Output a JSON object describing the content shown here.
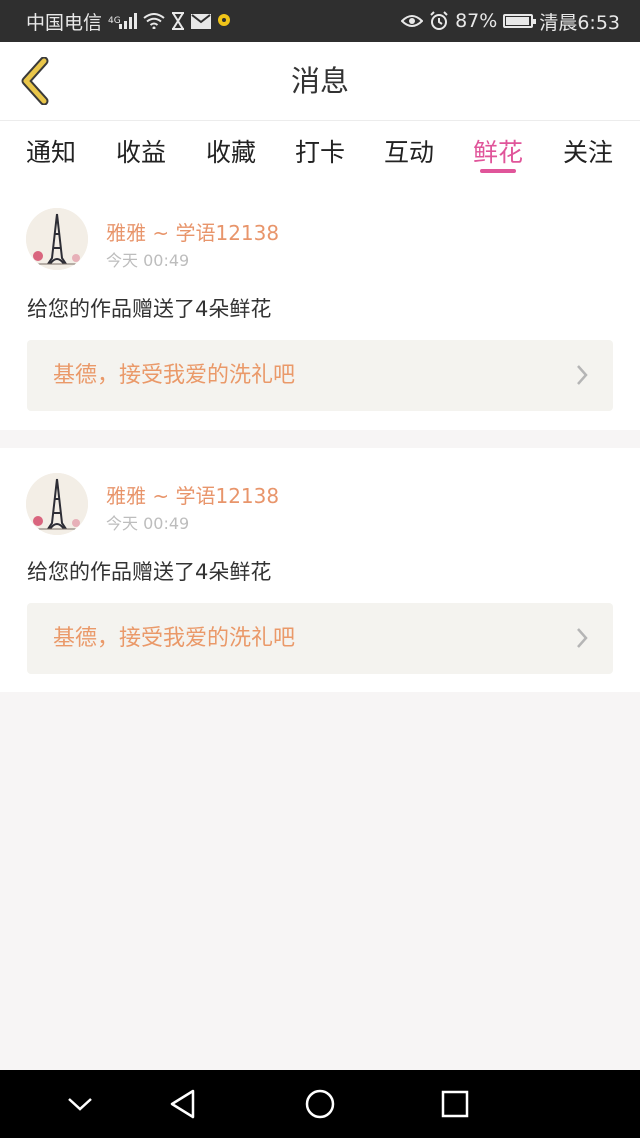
{
  "status_bar": {
    "carrier": "中国电信",
    "network": "4G",
    "battery": "87%",
    "battery_level": 0.87,
    "time": "清晨6:53",
    "icons": [
      "signal-icon",
      "wifi-icon",
      "hourglass-icon",
      "mail-icon",
      "notification-icon",
      "eye-icon",
      "alarm-icon",
      "battery-icon"
    ]
  },
  "header": {
    "title": "消息",
    "back_icon": "chevron-left-icon"
  },
  "tabs": [
    {
      "label": "通知"
    },
    {
      "label": "收益"
    },
    {
      "label": "收藏"
    },
    {
      "label": "打卡"
    },
    {
      "label": "互动"
    },
    {
      "label": "鲜花",
      "active": true
    },
    {
      "label": "关注"
    }
  ],
  "messages": [
    {
      "username": "雅雅 ~ 学语12138",
      "time": "今天 00:49",
      "text": "给您的作品赠送了4朵鲜花",
      "work_title": "基德，接受我爱的洗礼吧"
    },
    {
      "username": "雅雅 ~ 学语12138",
      "time": "今天 00:49",
      "text": "给您的作品赠送了4朵鲜花",
      "work_title": "基德，接受我爱的洗礼吧"
    }
  ],
  "colors": {
    "accent": "#e0559a",
    "username": "#e8956b",
    "work_title": "#ea9969",
    "back_icon": "#e9c64a"
  },
  "nav_bar": {
    "icons": [
      "hide-keyboard-icon",
      "back-triangle-icon",
      "home-circle-icon",
      "recents-square-icon"
    ]
  }
}
